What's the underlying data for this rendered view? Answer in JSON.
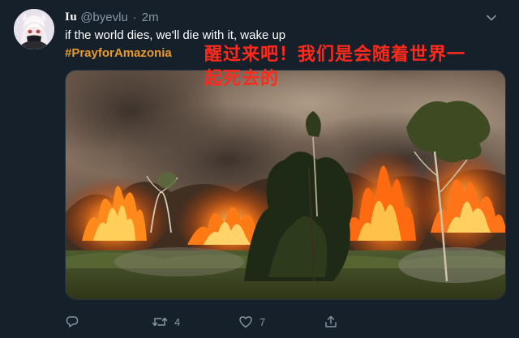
{
  "tweet": {
    "display_name": "Iu",
    "handle": "@byevlu",
    "separator": "·",
    "time": "2m",
    "text": "if the world dies, we'll die with it, wake up",
    "hashtag": "#PrayforAmazonia",
    "overlay_text": "醒过来吧！我们是会随着世界一起死去的",
    "accent_color": "#e99a2c",
    "overlay_color": "#ff2a1c"
  },
  "actions": {
    "reply": {
      "icon": "reply-icon",
      "count": ""
    },
    "retweet": {
      "icon": "retweet-icon",
      "count": "4"
    },
    "like": {
      "icon": "heart-icon",
      "count": "7"
    },
    "share": {
      "icon": "share-icon",
      "count": ""
    }
  },
  "icons": {
    "avatar": "anime-girl-avatar",
    "more": "chevron-down-icon"
  }
}
